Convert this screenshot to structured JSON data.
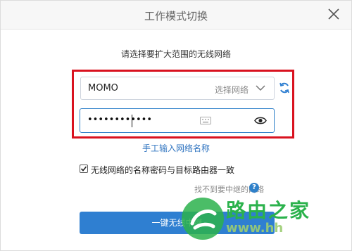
{
  "dialog": {
    "title": "工作模式切换",
    "subtitle": "请选择要扩大范围的无线网络",
    "ssid": {
      "value": "MOMO",
      "select_label": "选择网络"
    },
    "password": {
      "masked_value": "••••••••••••"
    },
    "manual_link": "手工输入网络名称",
    "sync_checkbox": {
      "label": "无线网络的名称密码与目标路由器一致",
      "checked": true
    },
    "not_found_link": "找不到要中继的网络",
    "help_icon_text": "?",
    "submit_label": "一键无线中继"
  },
  "watermark": {
    "title": "路由之家",
    "url": "www.hh"
  },
  "colors": {
    "accent": "#2f7fd1",
    "highlight": "#d9121f",
    "watermark": "#2bb24c"
  },
  "icons": [
    "close-icon",
    "chevron-down-icon",
    "refresh-icon",
    "keyboard-icon",
    "eye-icon",
    "help-icon",
    "checkbox-icon",
    "watermark-logo-icon"
  ]
}
